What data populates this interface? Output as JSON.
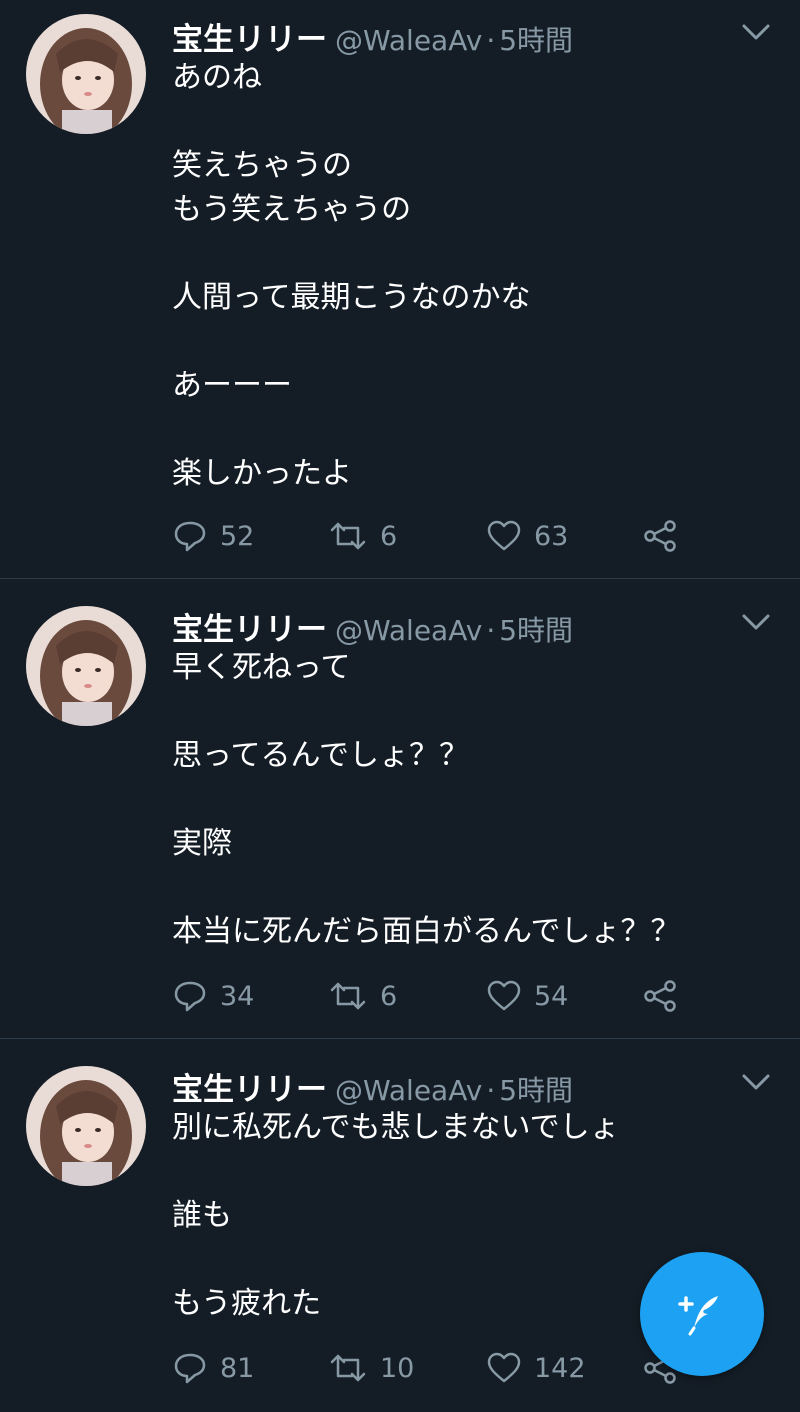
{
  "colors": {
    "background": "#141d26",
    "secondary_text": "#8899a6",
    "accent": "#1da1f2",
    "divider": "#2b3a48"
  },
  "tweets": [
    {
      "name": "宝生リリー",
      "handle": "@WaleaAv",
      "separator": "·",
      "time": "5時間",
      "lines": [
        "あのね",
        "",
        "笑えちゃうの",
        "もう笑えちゃうの",
        "",
        "人間って最期こうなのかな",
        "",
        "あーーー",
        "",
        "楽しかったよ"
      ],
      "replies": "52",
      "retweets": "6",
      "likes": "63"
    },
    {
      "name": "宝生リリー",
      "handle": "@WaleaAv",
      "separator": "·",
      "time": "5時間",
      "lines": [
        "早く死ねって",
        "",
        "思ってるんでしょ？？",
        "",
        "実際",
        "",
        "本当に死んだら面白がるんでしょ？？"
      ],
      "replies": "34",
      "retweets": "6",
      "likes": "54"
    },
    {
      "name": "宝生リリー",
      "handle": "@WaleaAv",
      "separator": "·",
      "time": "5時間",
      "lines": [
        "別に私死んでも悲しまないでしょ",
        "",
        "誰も",
        "",
        "もう疲れた"
      ],
      "replies": "81",
      "retweets": "10",
      "likes": "142"
    }
  ],
  "icons": {
    "reply": "reply-icon",
    "retweet": "retweet-icon",
    "like": "heart-icon",
    "share": "share-icon",
    "menu": "chevron-down-icon",
    "compose": "compose-tweet-icon"
  }
}
